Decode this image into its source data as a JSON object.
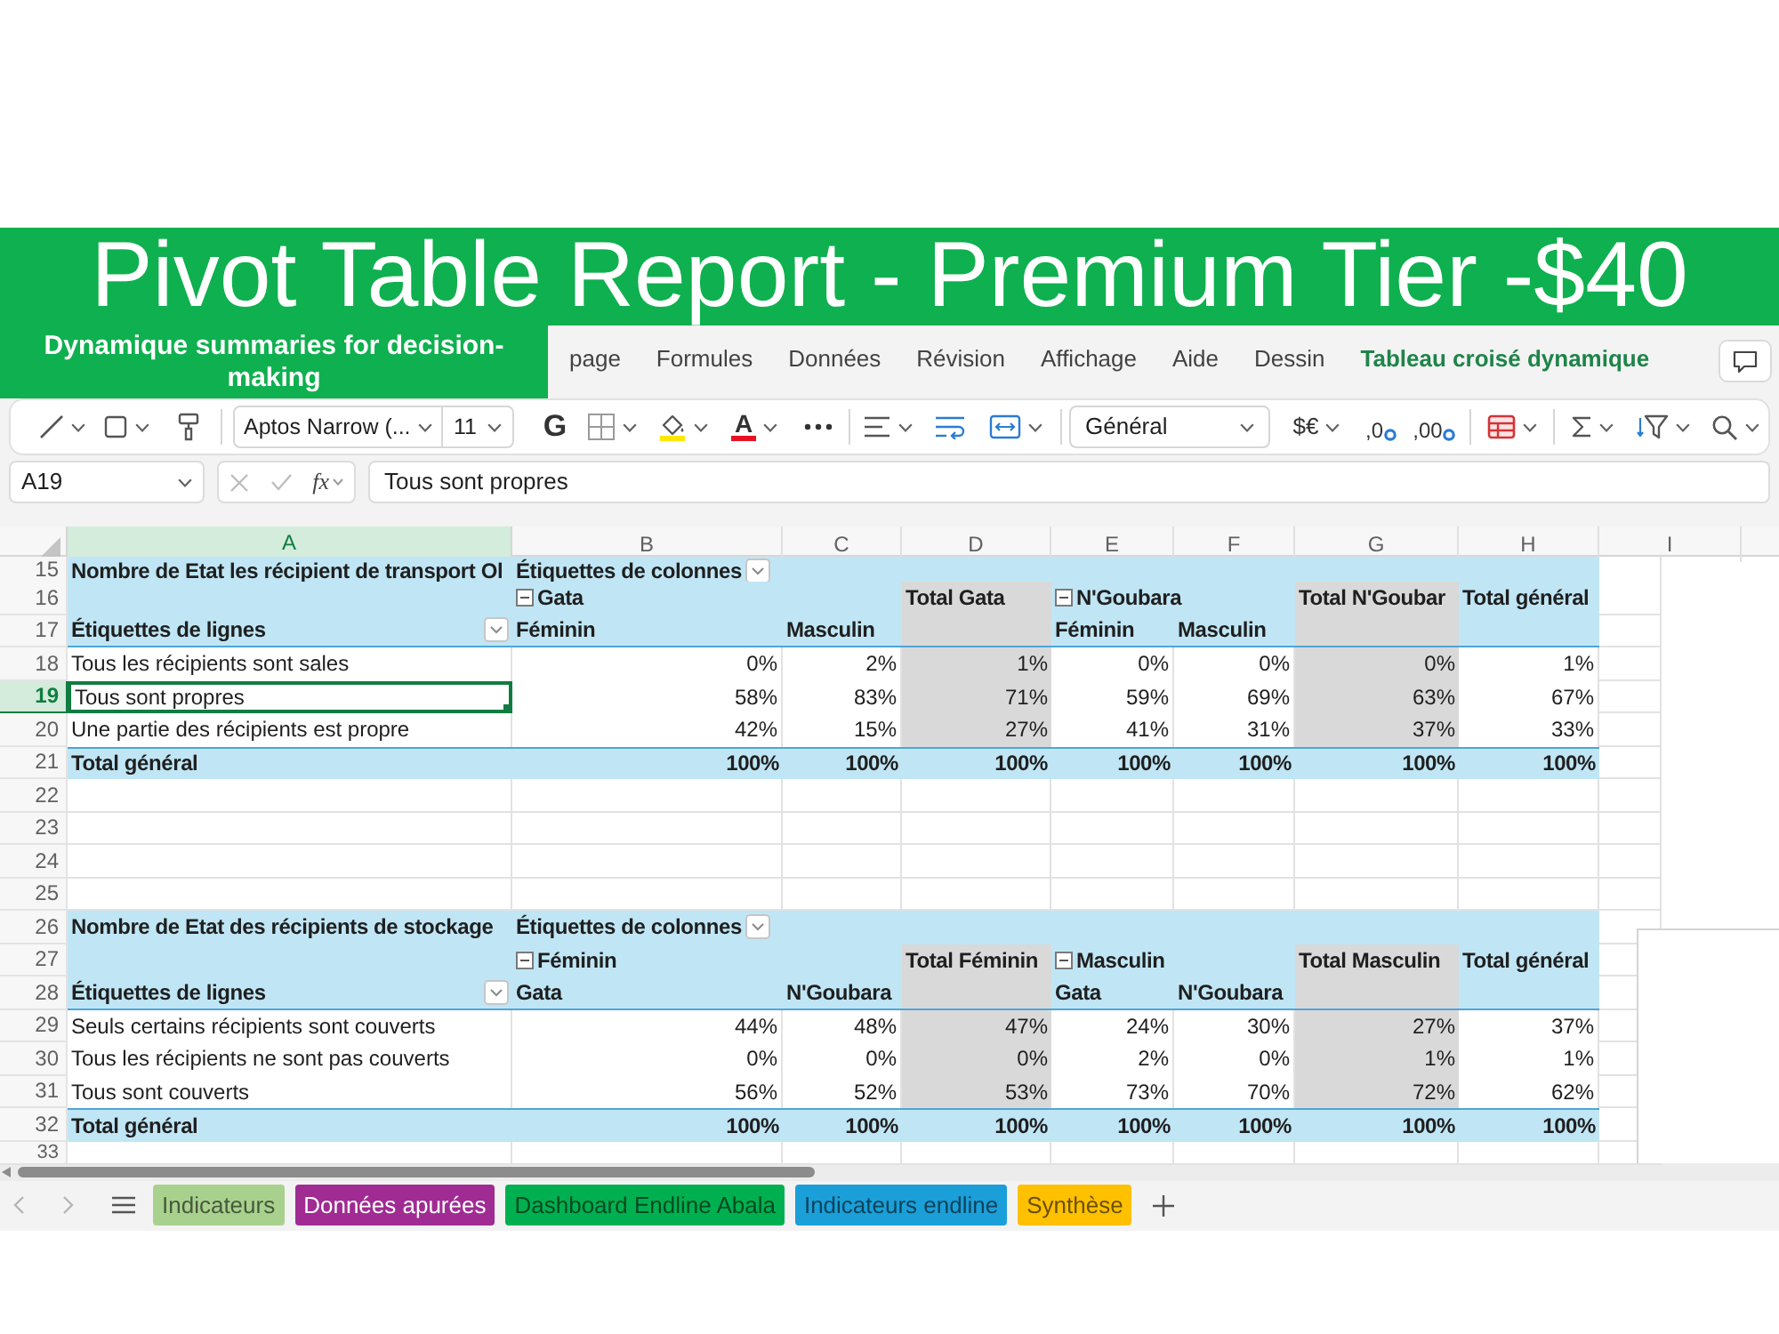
{
  "banner": {
    "title": "Pivot Table Report - Premium Tier -$40"
  },
  "overlay": {
    "text": "Dynamique summaries for decision-making"
  },
  "ribbon": {
    "tabs": [
      {
        "label": "page",
        "kind": "standard",
        "selected": false
      },
      {
        "label": "Formules",
        "kind": "standard",
        "selected": false
      },
      {
        "label": "Données",
        "kind": "standard",
        "selected": false
      },
      {
        "label": "Révision",
        "kind": "standard",
        "selected": false
      },
      {
        "label": "Affichage",
        "kind": "standard",
        "selected": false
      },
      {
        "label": "Aide",
        "kind": "standard",
        "selected": false
      },
      {
        "label": "Dessin",
        "kind": "standard",
        "selected": false
      },
      {
        "label": "Tableau croisé dynamique",
        "kind": "contextual",
        "selected": false
      }
    ]
  },
  "toolbar": {
    "font": "Aptos Narrow (...",
    "font_size": "11",
    "bold": "G",
    "font_color": "A",
    "number_format": "Général",
    "currency": "$€",
    "decimals": [
      ",0",
      ",00"
    ]
  },
  "formula_bar": {
    "name_box": "A19",
    "function": "fx",
    "value": "Tous sont propres"
  },
  "sheet": {
    "columns": [
      {
        "label": "A",
        "selected": true
      },
      {
        "label": "B",
        "selected": false
      },
      {
        "label": "C",
        "selected": false
      },
      {
        "label": "D",
        "selected": false
      },
      {
        "label": "E",
        "selected": false
      },
      {
        "label": "F",
        "selected": false
      },
      {
        "label": "G",
        "selected": false
      },
      {
        "label": "H",
        "selected": false
      },
      {
        "label": "I",
        "selected": false
      }
    ],
    "rows": [
      {
        "number": "15",
        "selected": false,
        "kind": "caption",
        "measure": "Nombre de Etat les récipient de transport Ol",
        "columns_label": "Étiquettes de colonnes"
      },
      {
        "number": "16",
        "selected": false,
        "kind": "groups",
        "groups": [
          {
            "label": "Gata",
            "expanded": true,
            "total_label": "Total Gata"
          },
          {
            "label": "N'Goubara",
            "expanded": true,
            "total_label": "Total N'Goubar"
          }
        ],
        "grand_total_label": "Total général"
      },
      {
        "number": "17",
        "selected": false,
        "kind": "header",
        "label": "Étiquettes de lignes",
        "members": [
          [
            "Féminin",
            "Masculin"
          ],
          [
            "Féminin",
            "Masculin"
          ]
        ]
      },
      {
        "number": "18",
        "selected": false,
        "kind": "data",
        "label": "Tous les récipients sont sales",
        "values": [
          "0%",
          "2%",
          "1%",
          "0%",
          "0%",
          "0%",
          "1%"
        ]
      },
      {
        "number": "19",
        "selected": true,
        "kind": "data",
        "label": "Tous sont propres",
        "values": [
          "58%",
          "83%",
          "71%",
          "59%",
          "69%",
          "63%",
          "67%"
        ]
      },
      {
        "number": "20",
        "selected": false,
        "kind": "data",
        "label": "Une partie des récipients est propre",
        "values": [
          "42%",
          "15%",
          "27%",
          "41%",
          "31%",
          "37%",
          "33%"
        ]
      },
      {
        "number": "21",
        "selected": false,
        "kind": "total",
        "label": "Total général",
        "values": [
          "100%",
          "100%",
          "100%",
          "100%",
          "100%",
          "100%",
          "100%"
        ]
      },
      {
        "number": "22",
        "selected": false,
        "kind": "blank"
      },
      {
        "number": "23",
        "selected": false,
        "kind": "blank"
      },
      {
        "number": "24",
        "selected": false,
        "kind": "blank"
      },
      {
        "number": "25",
        "selected": false,
        "kind": "blank"
      },
      {
        "number": "26",
        "selected": false,
        "kind": "caption",
        "measure": "Nombre de Etat des récipients de stockage",
        "columns_label": "Étiquettes de colonnes"
      },
      {
        "number": "27",
        "selected": false,
        "kind": "groups",
        "groups": [
          {
            "label": "Féminin",
            "expanded": true,
            "total_label": "Total Féminin"
          },
          {
            "label": "Masculin",
            "expanded": true,
            "total_label": "Total Masculin"
          }
        ],
        "grand_total_label": "Total général"
      },
      {
        "number": "28",
        "selected": false,
        "kind": "header",
        "label": "Étiquettes de lignes",
        "members": [
          [
            "Gata",
            "N'Goubara"
          ],
          [
            "Gata",
            "N'Goubara"
          ]
        ]
      },
      {
        "number": "29",
        "selected": false,
        "kind": "data",
        "label": "Seuls certains récipients sont couverts",
        "values": [
          "44%",
          "48%",
          "47%",
          "24%",
          "30%",
          "27%",
          "37%"
        ]
      },
      {
        "number": "30",
        "selected": false,
        "kind": "data",
        "label": "Tous les récipients ne sont pas couverts",
        "values": [
          "0%",
          "0%",
          "0%",
          "2%",
          "0%",
          "1%",
          "1%"
        ]
      },
      {
        "number": "31",
        "selected": false,
        "kind": "data",
        "label": "Tous sont couverts",
        "values": [
          "56%",
          "52%",
          "53%",
          "73%",
          "70%",
          "72%",
          "62%"
        ]
      },
      {
        "number": "32",
        "selected": false,
        "kind": "total",
        "label": "Total général",
        "values": [
          "100%",
          "100%",
          "100%",
          "100%",
          "100%",
          "100%",
          "100%"
        ]
      },
      {
        "number": "33",
        "selected": false,
        "kind": "blank"
      }
    ]
  },
  "sheet_tabs": [
    {
      "label": "Indicateurs",
      "color": "#a9d18e",
      "selected": false
    },
    {
      "label": "Données apurées",
      "color": "#a02b93",
      "selected": false
    },
    {
      "label": "Dashboard Endline Abala",
      "color": "#00b050",
      "selected": false
    },
    {
      "label": "Indicateurs endline",
      "color": "#1b9fd8",
      "selected": false
    },
    {
      "label": "Synthèse",
      "color": "#ffc000",
      "selected": false
    }
  ]
}
